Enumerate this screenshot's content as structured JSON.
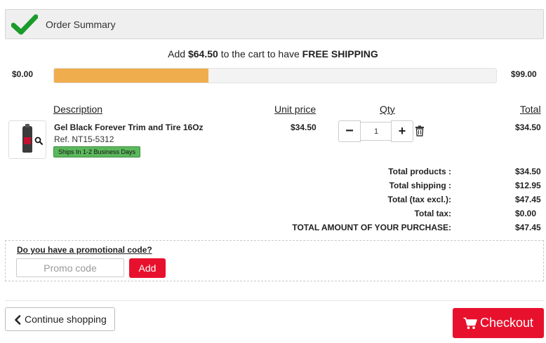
{
  "header": {
    "title": "Order Summary",
    "check_icon": "checkmark-icon"
  },
  "free_shipping": {
    "prefix": "Add",
    "amount": "$64.50",
    "middle": "to the cart to have",
    "highlight": "FREE SHIPPING"
  },
  "progress": {
    "min_label": "$0.00",
    "max_label": "$99.00",
    "fraction": 0.3485
  },
  "cart_table": {
    "headers": {
      "description": "Description",
      "unit_price": "Unit price",
      "qty": "Qty",
      "total": "Total"
    },
    "items": [
      {
        "name": "Gel Black Forever Trim and Tire 16Oz",
        "ref": "Ref. NT15-5312",
        "badge": "Ships In 1-2 Business Days",
        "unit_price": "$34.50",
        "qty": "1",
        "total": "$34.50",
        "minus": "−",
        "plus": "+"
      }
    ]
  },
  "totals": [
    {
      "label": "Total products :",
      "value": "$34.50"
    },
    {
      "label": "Total shipping :",
      "value": "$12.95"
    },
    {
      "label": "Total  (tax excl.):",
      "value": "$47.45"
    },
    {
      "label": "Total tax:",
      "value": "$0.00"
    },
    {
      "label": "TOTAL AMOUNT OF YOUR PURCHASE:",
      "value": "$47.45"
    }
  ],
  "promo": {
    "question": "Do you have a promotional code?",
    "placeholder": "Promo code",
    "add_label": "Add"
  },
  "actions": {
    "continue_label": "Continue shopping",
    "checkout_label": "Checkout"
  },
  "colors": {
    "accent": "#e8112d",
    "progress": "#f0ad4e",
    "check": "#1a9b2a",
    "badge": "#5cb85c"
  }
}
